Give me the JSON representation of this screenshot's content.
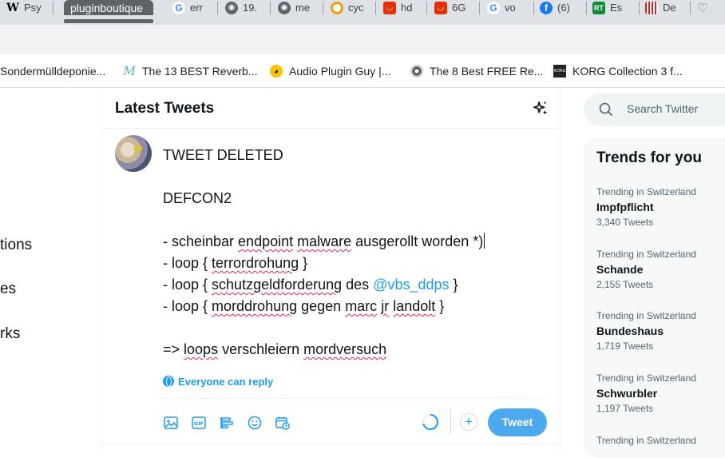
{
  "browser": {
    "tabs": [
      {
        "label": "Psy",
        "icon": "wikipedia-icon"
      },
      {
        "label": "pluginboutique",
        "icon": "",
        "active": true
      },
      {
        "label": "err",
        "icon": "google-icon"
      },
      {
        "label": "19.",
        "icon": "globe-icon"
      },
      {
        "label": "me",
        "icon": "globe-icon"
      },
      {
        "label": "cyc",
        "icon": "orange-icon"
      },
      {
        "label": "hd",
        "icon": "aliexpress-icon"
      },
      {
        "label": "6G",
        "icon": "aliexpress-icon"
      },
      {
        "label": "vo",
        "icon": "google-icon"
      },
      {
        "label": "(6)",
        "icon": "facebook-icon"
      },
      {
        "label": "Es",
        "icon": "rt-icon"
      },
      {
        "label": "De",
        "icon": "striped-icon"
      },
      {
        "label": "",
        "icon": "heart-outline-icon"
      }
    ],
    "bookmarks": [
      {
        "label": "Sondermülldeponie...",
        "icon": ""
      },
      {
        "label": "The 13 BEST Reverb...",
        "icon": "m-script-icon"
      },
      {
        "label": "Audio Plugin Guy |...",
        "icon": "pacman-icon"
      },
      {
        "label": "The 8 Best FREE Re...",
        "icon": "disc-icon"
      },
      {
        "label": "KORG Collection 3 f...",
        "icon": "korg-icon"
      }
    ]
  },
  "leftnav": {
    "items": [
      "tions",
      "es",
      "rks"
    ]
  },
  "main": {
    "title": "Latest Tweets",
    "compose": {
      "line1": "TWEET DELETED",
      "line2": "DEFCON2",
      "line3_prefix": "- scheinbar ",
      "line3_w1": "endpoint",
      "line3_sp": " ",
      "line3_w2": "malware",
      "line3_suffix": " ausgerollt worden *)",
      "line4_prefix": "- loop { ",
      "line4_w1": "terrordrohung",
      "line4_suffix": " }",
      "line5_prefix": "- loop { ",
      "line5_w1": "schutzgeldforderung",
      "line5_mid": " des ",
      "line5_mention": "@vbs_ddps",
      "line5_suffix": " }",
      "line6_prefix": "- loop { ",
      "line6_w1": "morddrohung",
      "line6_mid1": " gegen ",
      "line6_w2": "marc",
      "line6_mid2": " ",
      "line6_w3": "jr",
      "line6_mid3": " ",
      "line6_w4": "landolt",
      "line6_suffix": " }",
      "line7_prefix": "=> ",
      "line7_w1": "loops",
      "line7_mid": " verschleiern ",
      "line7_w2": "mordversuch"
    },
    "reply_setting": "Everyone can reply",
    "tweet_button": "Tweet",
    "add_button": "+"
  },
  "right": {
    "search_placeholder": "Search Twitter",
    "trends_title": "Trends for you",
    "trends": [
      {
        "context": "Trending in Switzerland",
        "name": "Impfpflicht",
        "count": "3,340 Tweets"
      },
      {
        "context": "Trending in Switzerland",
        "name": "Schande",
        "count": "2,155 Tweets"
      },
      {
        "context": "Trending in Switzerland",
        "name": "Bundeshaus",
        "count": "1,719 Tweets"
      },
      {
        "context": "Trending in Switzerland",
        "name": "Schwurbler",
        "count": "1,197 Tweets"
      },
      {
        "context": "Trending in Switzerland",
        "name": "",
        "count": ""
      }
    ]
  },
  "colors": {
    "accent": "#1d9bf0",
    "tweet_button": "#4ca9ee",
    "spell_underline": "#e0245e",
    "text_primary": "#0f1419",
    "text_secondary": "#536471"
  }
}
